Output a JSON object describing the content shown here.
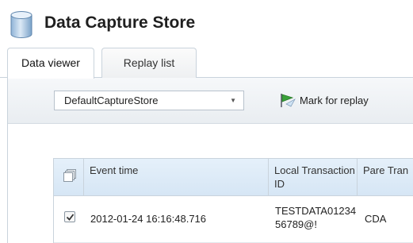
{
  "header": {
    "title": "Data Capture Store",
    "icon": "database-icon"
  },
  "tabs": [
    {
      "label": "Data viewer",
      "active": true
    },
    {
      "label": "Replay list",
      "active": false
    }
  ],
  "toolbar": {
    "store_select": {
      "value": "DefaultCaptureStore"
    },
    "mark_replay": {
      "label": "Mark for replay",
      "icon": "flag-icon"
    }
  },
  "table": {
    "columns": [
      {
        "label": "",
        "icon": "select-all-icon"
      },
      {
        "label": "Event time"
      },
      {
        "label": "Local Transaction ID"
      },
      {
        "label": "Pare Tran"
      }
    ],
    "rows": [
      {
        "checked": true,
        "event_time": "2012-01-24 16:16:48.716",
        "local_transaction_id": "TESTDATA01234 56789@!",
        "parent": "CDA"
      }
    ]
  },
  "colors": {
    "header_gradient_top": "#e5f0fa",
    "header_gradient_bottom": "#d6e6f5",
    "border": "#c9d3dc",
    "accent_green": "#3aa13a"
  }
}
